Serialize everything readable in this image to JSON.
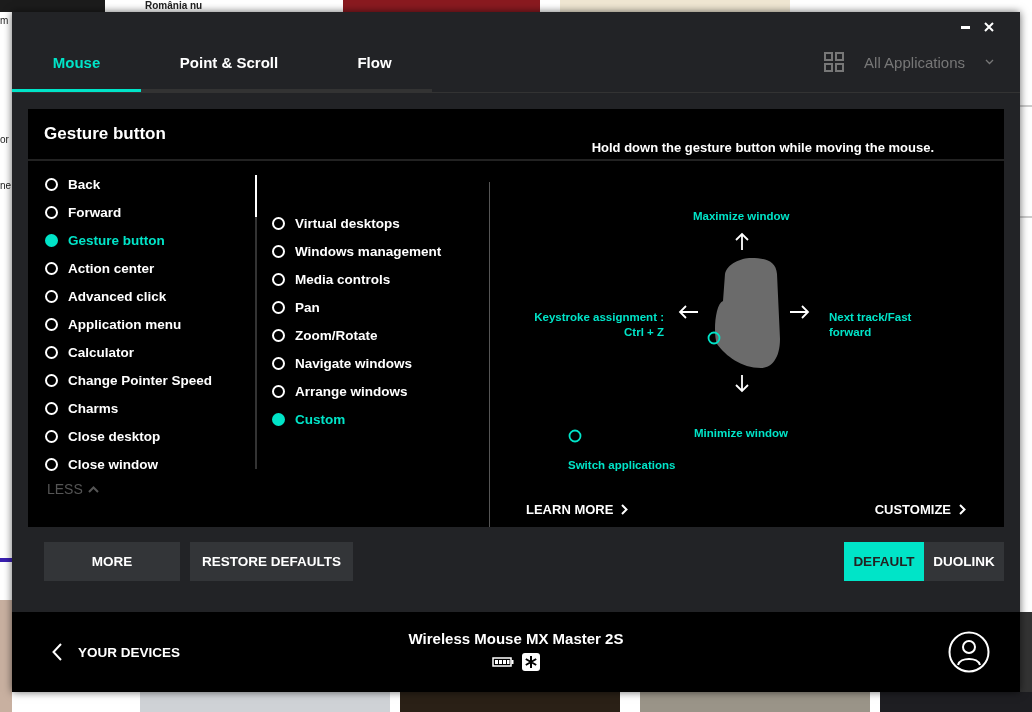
{
  "background": {
    "headline": "România nu",
    "fragments": [
      "m",
      "or",
      "ne"
    ]
  },
  "tabs": [
    {
      "label": "Mouse",
      "selected": true
    },
    {
      "label": "Point & Scroll",
      "selected": false
    },
    {
      "label": "Flow",
      "selected": false
    }
  ],
  "app_selector": {
    "label": "All Applications"
  },
  "panel": {
    "title": "Gesture button",
    "hint": "Hold down the gesture button while moving the mouse.",
    "actions": [
      {
        "label": "Back",
        "selected": false
      },
      {
        "label": "Forward",
        "selected": false
      },
      {
        "label": "Gesture button",
        "selected": true
      },
      {
        "label": "Action center",
        "selected": false
      },
      {
        "label": "Advanced click",
        "selected": false
      },
      {
        "label": "Application menu",
        "selected": false
      },
      {
        "label": "Calculator",
        "selected": false
      },
      {
        "label": "Change Pointer Speed",
        "selected": false
      },
      {
        "label": "Charms",
        "selected": false
      },
      {
        "label": "Close desktop",
        "selected": false
      },
      {
        "label": "Close window",
        "selected": false
      }
    ],
    "gestures": [
      {
        "label": "Virtual desktops",
        "selected": false
      },
      {
        "label": "Windows management",
        "selected": false
      },
      {
        "label": "Media controls",
        "selected": false
      },
      {
        "label": "Pan",
        "selected": false
      },
      {
        "label": "Zoom/Rotate",
        "selected": false
      },
      {
        "label": "Navigate windows",
        "selected": false
      },
      {
        "label": "Arrange windows",
        "selected": false
      },
      {
        "label": "Custom",
        "selected": true
      }
    ],
    "less": "LESS",
    "diagram": {
      "up": "Maximize window",
      "down": "Minimize window",
      "left": "Keystroke assignment : Ctrl + Z",
      "right": "Next track/Fast forward",
      "click": "Switch applications"
    },
    "learn_more": "LEARN MORE",
    "customize": "CUSTOMIZE"
  },
  "buttons": [
    "MORE",
    "RESTORE DEFAULTS"
  ],
  "modes": [
    {
      "label": "DEFAULT",
      "selected": true
    },
    {
      "label": "DUOLINK",
      "selected": false
    }
  ],
  "footer": {
    "back": "YOUR DEVICES",
    "device": "Wireless Mouse MX Master 2S"
  }
}
